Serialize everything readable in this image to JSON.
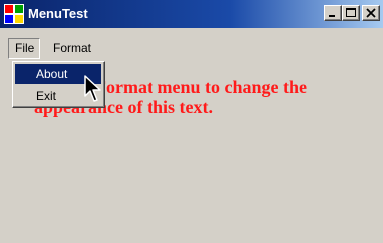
{
  "window": {
    "title": "MenuTest",
    "icons": {
      "app": "app-icon",
      "minimize": "minimize-icon",
      "maximize": "maximize-icon",
      "close": "close-icon"
    }
  },
  "menubar": {
    "file_label": "File",
    "format_label": "Format"
  },
  "file_menu": {
    "about_label": "About",
    "exit_label": "Exit"
  },
  "content": {
    "text": "Use the Format menu to change the appearance of this text."
  },
  "colors": {
    "titlebar_start": "#0a246a",
    "titlebar_end": "#a6caf0",
    "face": "#d4d0c8",
    "highlight": "#0a246a",
    "content_text": "#ff1a1a"
  },
  "cursor": "arrow-cursor-icon"
}
